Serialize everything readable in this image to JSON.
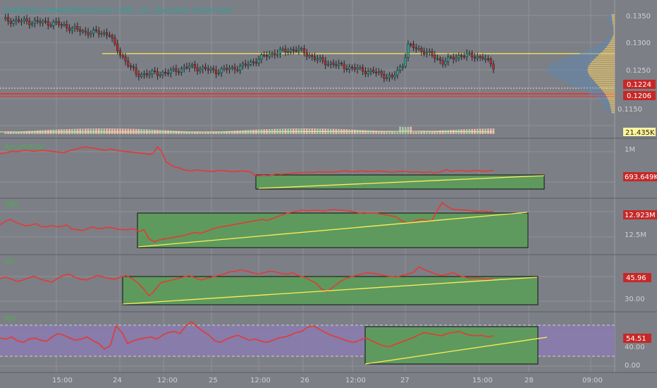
{
  "header": {
    "title": "ZOMEDICA PHARMACEUTICALS CORP., 15, Cboe BZX, Heikin Ashi"
  },
  "price_axis": {
    "ticks": [
      "0.1350",
      "0.1300",
      "0.1250",
      "0.1224",
      "0.1206",
      "0.1150"
    ]
  },
  "volume": {
    "label": "21.435K"
  },
  "x_axis": {
    "ticks": [
      "15:00",
      "24",
      "12:00",
      "25",
      "12:00",
      "26",
      "12:00",
      "27",
      "15:00",
      "28",
      "09:00"
    ]
  },
  "panels": [
    {
      "name": "Accum/Dist",
      "value": "693.649K",
      "ticks": [
        "1M"
      ]
    },
    {
      "name": "OBV",
      "value": "12.923M",
      "ticks": [
        "12.5M"
      ]
    },
    {
      "name": "UO",
      "value": "45.96",
      "ticks": [
        "30.00"
      ]
    },
    {
      "name": "RSI",
      "value": "54.51",
      "ticks": [
        "40.00",
        "0.00"
      ]
    }
  ],
  "colors": {
    "background": "#7c7f86",
    "up": "#26a69a",
    "down": "#c62828",
    "indicator": "#e53935",
    "trendline": "#ffee58",
    "channel_fill": "#5e9a5e",
    "rsi_band": "#8a7bb0",
    "support": "#e53935",
    "resistance": "#ffee58"
  },
  "chart_data": [
    {
      "type": "candlestick",
      "title": "ZOMEDICA PHARMACEUTICALS CORP., 15, Cboe BZX, Heikin Ashi",
      "x_ticks": [
        "15:00",
        "24",
        "12:00",
        "25",
        "12:00",
        "26",
        "12:00",
        "27",
        "15:00",
        "28",
        "09:00"
      ],
      "y_range": [
        0.112,
        0.136
      ],
      "last_price": 0.1224,
      "support_level": 0.1206,
      "resistance_level": 0.128,
      "key_points": [
        {
          "t": 0,
          "close": 0.1335
        },
        {
          "t": 20,
          "close": 0.1328
        },
        {
          "t": 30,
          "close": 0.131
        },
        {
          "t": 40,
          "close": 0.1306
        },
        {
          "t": 42,
          "close": 0.1278
        },
        {
          "t": 50,
          "close": 0.1218
        },
        {
          "t": 62,
          "close": 0.1222
        },
        {
          "t": 70,
          "close": 0.1235
        },
        {
          "t": 80,
          "close": 0.1225
        },
        {
          "t": 90,
          "close": 0.1235
        },
        {
          "t": 100,
          "close": 0.1262
        },
        {
          "t": 110,
          "close": 0.1273
        },
        {
          "t": 120,
          "close": 0.1245
        },
        {
          "t": 132,
          "close": 0.123
        },
        {
          "t": 140,
          "close": 0.1222
        },
        {
          "t": 146,
          "close": 0.121
        },
        {
          "t": 150,
          "close": 0.124
        },
        {
          "t": 152,
          "close": 0.128
        },
        {
          "t": 158,
          "close": 0.1268
        },
        {
          "t": 165,
          "close": 0.1245
        },
        {
          "t": 172,
          "close": 0.126
        },
        {
          "t": 180,
          "close": 0.1255
        },
        {
          "t": 184,
          "close": 0.1235
        }
      ]
    },
    {
      "type": "line",
      "title": "Accum/Dist",
      "last_value": "693.649K",
      "y_ticks": [
        "1M"
      ],
      "values": [
        0.8,
        0.81,
        0.83,
        0.85,
        0.84,
        0.86,
        0.87,
        0.86,
        0.85,
        0.86,
        0.87,
        0.86,
        0.85,
        0.84,
        0.83,
        0.82,
        0.85,
        0.88,
        0.9,
        0.93,
        0.95,
        0.93,
        0.92,
        0.9,
        0.88,
        0.87,
        0.9,
        0.88,
        0.86,
        0.85,
        0.84,
        0.83,
        0.82,
        0.81,
        0.8,
        0.78,
        0.8,
        0.95,
        0.85,
        0.62,
        0.55,
        0.5,
        0.48,
        0.44,
        0.42,
        0.41,
        0.43,
        0.42,
        0.41,
        0.4,
        0.4,
        0.41,
        0.42,
        0.41,
        0.4,
        0.39,
        0.4,
        0.41,
        0.4,
        0.38,
        0.3,
        0.3,
        0.31,
        0.3,
        0.32,
        0.34,
        0.33,
        0.34,
        0.35,
        0.36,
        0.37,
        0.37,
        0.38,
        0.37,
        0.38,
        0.39,
        0.38,
        0.39,
        0.38,
        0.39,
        0.4,
        0.41,
        0.4,
        0.39,
        0.4,
        0.41,
        0.4,
        0.39,
        0.4,
        0.41,
        0.4,
        0.39,
        0.38,
        0.39,
        0.4,
        0.4,
        0.39,
        0.38,
        0.39,
        0.38,
        0.37,
        0.39,
        0.36,
        0.38,
        0.4,
        0.44,
        0.4,
        0.41,
        0.42,
        0.41,
        0.4,
        0.41,
        0.42,
        0.41,
        0.4,
        0.41,
        0.42
      ]
    },
    {
      "type": "line",
      "title": "OBV",
      "last_value": "12.923M",
      "y_ticks": [
        "12.5M"
      ],
      "values": [
        0.5,
        0.58,
        0.62,
        0.56,
        0.52,
        0.48,
        0.5,
        0.53,
        0.47,
        0.46,
        0.49,
        0.46,
        0.47,
        0.5,
        0.41,
        0.4,
        0.38,
        0.42,
        0.46,
        0.42,
        0.43,
        0.45,
        0.44,
        0.41,
        0.4,
        0.4,
        0.42,
        0.36,
        0.4,
        0.2,
        0.14,
        0.18,
        0.2,
        0.22,
        0.24,
        0.26,
        0.28,
        0.32,
        0.34,
        0.32,
        0.36,
        0.4,
        0.44,
        0.46,
        0.48,
        0.5,
        0.52,
        0.54,
        0.56,
        0.58,
        0.6,
        0.62,
        0.6,
        0.64,
        0.68,
        0.72,
        0.76,
        0.78,
        0.8,
        0.82,
        0.8,
        0.82,
        0.81,
        0.8,
        0.82,
        0.83,
        0.82,
        0.81,
        0.8,
        0.78,
        0.76,
        0.77,
        0.75,
        0.76,
        0.74,
        0.72,
        0.7,
        0.68,
        0.6,
        0.55,
        0.55,
        0.6,
        0.62,
        0.6,
        0.59,
        0.8,
        0.98,
        0.9,
        0.84,
        0.83,
        0.82,
        0.82,
        0.8,
        0.79,
        0.8,
        0.78,
        0.79
      ]
    },
    {
      "type": "line",
      "title": "UO",
      "last_value": "45.96",
      "y_ticks": [
        "30.00"
      ],
      "values": [
        46,
        48,
        45,
        42,
        44,
        47,
        49,
        45,
        43,
        41,
        46,
        50,
        52,
        48,
        45,
        44,
        47,
        50,
        48,
        46,
        45,
        48,
        50,
        46,
        40,
        32,
        22,
        30,
        40,
        42,
        44,
        46,
        48,
        50,
        47,
        44,
        46,
        48,
        50,
        52,
        55,
        56,
        58,
        56,
        54,
        52,
        54,
        56,
        55,
        53,
        52,
        54,
        50,
        48,
        44,
        40,
        32,
        28,
        34,
        40,
        45,
        48,
        50,
        52,
        54,
        53,
        52,
        50,
        49,
        48,
        50,
        52,
        54,
        62,
        58,
        55,
        52,
        50,
        52,
        54,
        50,
        48,
        46,
        47,
        46,
        45,
        46
      ]
    },
    {
      "type": "line",
      "title": "RSI",
      "last_value": "54.51",
      "y_ticks": [
        "40.00",
        "0.00"
      ],
      "values": [
        50,
        48,
        52,
        45,
        42,
        48,
        50,
        46,
        44,
        52,
        58,
        55,
        50,
        46,
        48,
        52,
        45,
        40,
        30,
        36,
        72,
        60,
        40,
        45,
        48,
        50,
        52,
        48,
        55,
        60,
        62,
        58,
        72,
        80,
        70,
        62,
        55,
        45,
        42,
        48,
        52,
        55,
        50,
        46,
        48,
        44,
        42,
        46,
        50,
        52,
        55,
        60,
        62,
        70,
        72,
        66,
        60,
        55,
        52,
        48,
        44,
        42,
        46,
        50,
        45,
        40,
        36,
        34,
        38,
        42,
        46,
        50,
        55,
        60,
        58,
        56,
        54,
        58,
        60,
        62,
        58,
        55,
        54,
        55,
        52,
        54
      ]
    }
  ]
}
